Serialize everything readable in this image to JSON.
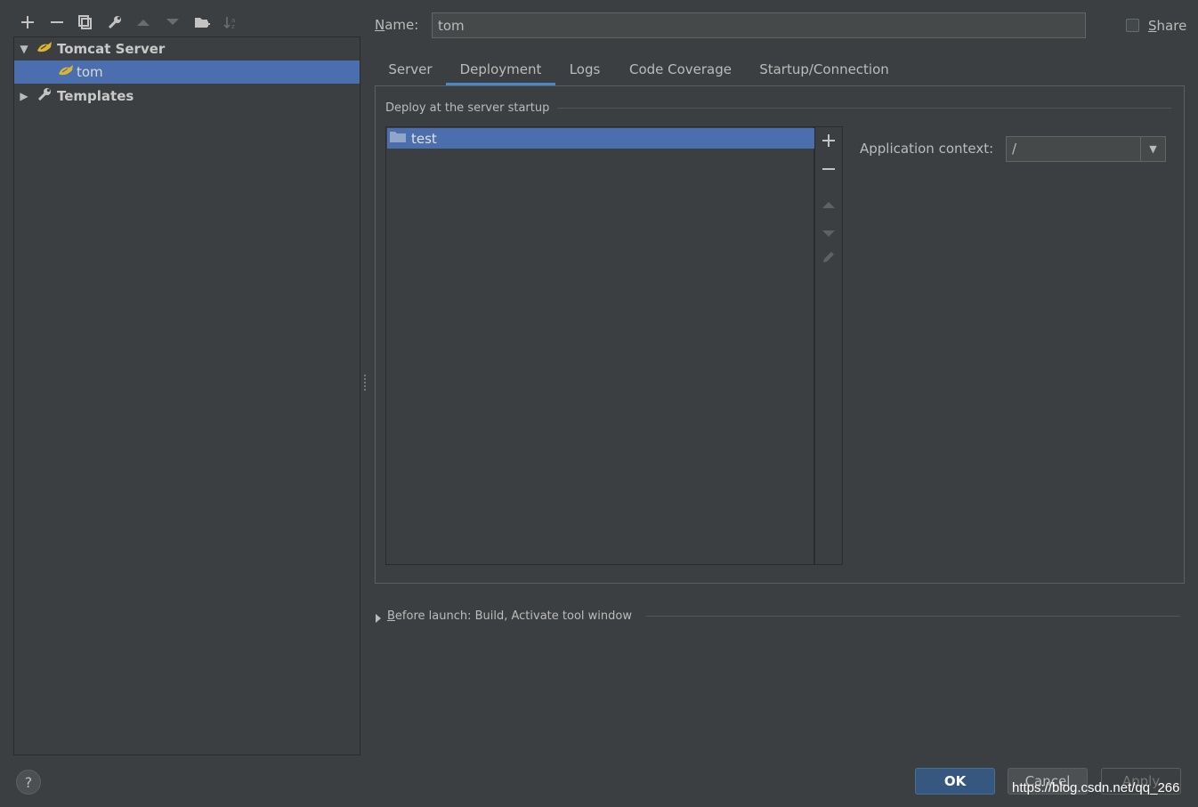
{
  "toolbar": {
    "icons": [
      "plus-icon",
      "minus-icon",
      "copy-icon",
      "wrench-icon",
      "arrow-up-icon",
      "arrow-down-icon",
      "folder-add-icon",
      "sort-icon"
    ]
  },
  "tree": {
    "root_label": "Tomcat Server",
    "child_label": "tom",
    "templates_label": "Templates"
  },
  "name": {
    "label_underline": "N",
    "label_rest": "ame:",
    "value": "tom"
  },
  "share": {
    "label_underline": "S",
    "label_rest": "hare",
    "checked": false
  },
  "tabs": [
    {
      "label": "Server",
      "active": false
    },
    {
      "label": "Deployment",
      "active": true
    },
    {
      "label": "Logs",
      "active": false
    },
    {
      "label": "Code Coverage",
      "active": false
    },
    {
      "label": "Startup/Connection",
      "active": false
    }
  ],
  "deploy": {
    "group_title": "Deploy at the server startup",
    "items": [
      {
        "label": "test",
        "selected": true
      }
    ]
  },
  "app_context": {
    "label": "Application context:",
    "value": "/"
  },
  "before_launch": {
    "label_underline": "B",
    "label_rest": "efore launch: Build, Activate tool window"
  },
  "buttons": {
    "ok": "OK",
    "cancel": "Cancel",
    "apply": "Apply"
  },
  "watermark": "https://blog.csdn.net/qq_266",
  "colors": {
    "background": "#3c3f41",
    "selection": "#4b6eaf",
    "ok_button": "#365880",
    "tab_indicator": "#4a88c7"
  }
}
